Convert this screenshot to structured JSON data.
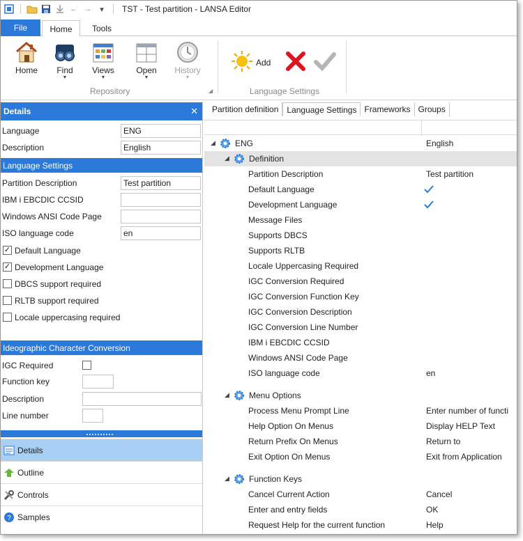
{
  "window": {
    "title": "TST - Test partition - LANSA Editor"
  },
  "ribbon": {
    "tabs": {
      "file": "File",
      "home": "Home",
      "tools": "Tools"
    },
    "buttons": {
      "home": "Home",
      "find": "Find",
      "views": "Views",
      "open": "Open",
      "history": "History",
      "add": "Add"
    },
    "groups": {
      "repository": "Repository",
      "language_settings": "Language Settings"
    }
  },
  "details": {
    "title": "Details",
    "fields": [
      {
        "label": "Language",
        "value": "ENG"
      },
      {
        "label": "Description",
        "value": "English"
      }
    ],
    "language_settings_header": "Language Settings",
    "ls_fields": [
      {
        "label": "Partition Description",
        "value": "Test partition"
      },
      {
        "label": "IBM i EBCDIC CCSID",
        "value": ""
      },
      {
        "label": "Windows ANSI Code Page",
        "value": ""
      },
      {
        "label": "ISO language code",
        "value": "en"
      }
    ],
    "checkboxes": [
      {
        "label": "Default Language",
        "checked": true
      },
      {
        "label": "Development Language",
        "checked": true
      },
      {
        "label": "DBCS support required",
        "checked": false
      },
      {
        "label": "RLTB support required",
        "checked": false
      },
      {
        "label": "Locale uppercasing required",
        "checked": false
      }
    ],
    "igc_header": "Ideographic Character Conversion",
    "igc_fields": {
      "igc_required": "IGC Required",
      "function_key": "Function key",
      "description": "Description",
      "line_number": "Line number"
    }
  },
  "nav": [
    {
      "label": "Details",
      "icon": "details-icon",
      "active": true
    },
    {
      "label": "Outline",
      "icon": "outline-icon",
      "active": false
    },
    {
      "label": "Controls",
      "icon": "controls-icon",
      "active": false
    },
    {
      "label": "Samples",
      "icon": "samples-icon",
      "active": false
    }
  ],
  "doc_tabs": [
    "Partition definition",
    "Language Settings",
    "Frameworks",
    "Groups"
  ],
  "tree": {
    "root": {
      "name": "ENG",
      "value": "English"
    },
    "definition": {
      "label": "Definition",
      "rows": [
        {
          "name": "Partition Description",
          "value": "Test partition"
        },
        {
          "name": "Default Language",
          "value": "",
          "check": true
        },
        {
          "name": "Development Language",
          "value": "",
          "check": true
        },
        {
          "name": "Message Files",
          "value": ""
        },
        {
          "name": "Supports DBCS",
          "value": ""
        },
        {
          "name": "Supports RLTB",
          "value": ""
        },
        {
          "name": "Locale Uppercasing Required",
          "value": ""
        },
        {
          "name": "IGC Conversion Required",
          "value": ""
        },
        {
          "name": "IGC Conversion Function Key",
          "value": ""
        },
        {
          "name": "IGC Conversion Description",
          "value": ""
        },
        {
          "name": "IGC Conversion Line Number",
          "value": ""
        },
        {
          "name": "IBM i EBCDIC CCSID",
          "value": ""
        },
        {
          "name": "Windows ANSI Code Page",
          "value": ""
        },
        {
          "name": "ISO language code",
          "value": "en"
        }
      ]
    },
    "menu_options": {
      "label": "Menu Options",
      "rows": [
        {
          "name": "Process Menu Prompt Line",
          "value": "Enter number of functi"
        },
        {
          "name": "Help Option On Menus",
          "value": "Display HELP Text"
        },
        {
          "name": "Return Prefix On Menus",
          "value": "Return to"
        },
        {
          "name": "Exit Option On Menus",
          "value": "Exit from Application"
        }
      ]
    },
    "function_keys": {
      "label": "Function Keys",
      "rows": [
        {
          "name": "Cancel Current Action",
          "value": "Cancel"
        },
        {
          "name": "Enter and entry fields",
          "value": "OK"
        },
        {
          "name": "Request Help for the current function",
          "value": "Help"
        }
      ]
    }
  },
  "colors": {
    "accent": "#2b79d8",
    "nav_active": "#a8d0f5",
    "check": "#2b79d8",
    "delete": "#e0141e"
  }
}
